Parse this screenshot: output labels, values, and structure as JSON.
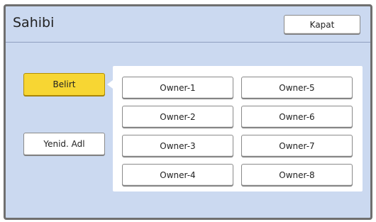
{
  "header": {
    "title": "Sahibi",
    "close_label": "Kapat"
  },
  "sidebar": {
    "specify_label": "Belirt",
    "rename_label": "Yenid. Adl"
  },
  "owners": [
    "Owner-1",
    "Owner-2",
    "Owner-3",
    "Owner-4",
    "Owner-5",
    "Owner-6",
    "Owner-7",
    "Owner-8"
  ],
  "colors": {
    "panel_bg": "#cbd9f0",
    "active_button": "#f7d633",
    "frame": "#6f6f6f"
  }
}
